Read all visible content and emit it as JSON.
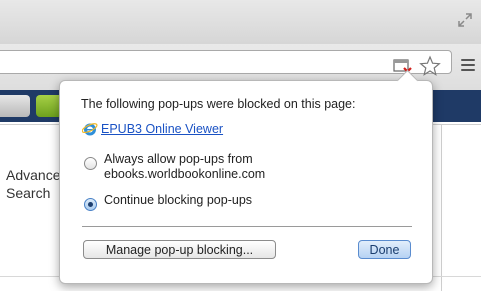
{
  "page": {
    "advanced_search_line1": "Advanced",
    "advanced_search_line2": "Search"
  },
  "popup": {
    "title": "The following pop-ups were blocked on this page:",
    "blocked_site_link": "EPUB3 Online Viewer",
    "options": [
      {
        "label_line1": "Always allow pop-ups from",
        "label_line2": "ebooks.worldbookonline.com",
        "selected": false
      },
      {
        "label_line1": "Continue blocking pop-ups",
        "selected": true
      }
    ],
    "manage_button": "Manage pop-up blocking...",
    "done_button": "Done"
  },
  "icons": {
    "blocked_popup": "popup-blocked-icon",
    "bookmark": "star-icon",
    "menu": "menu-icon",
    "fullscreen": "fullscreen-icon",
    "site": "ie-icon"
  },
  "colors": {
    "nav_bar": "#1f3a66",
    "nav_button_green": "#6ea11d",
    "link": "#1a52c4",
    "done_button": "#b6d2f3"
  }
}
